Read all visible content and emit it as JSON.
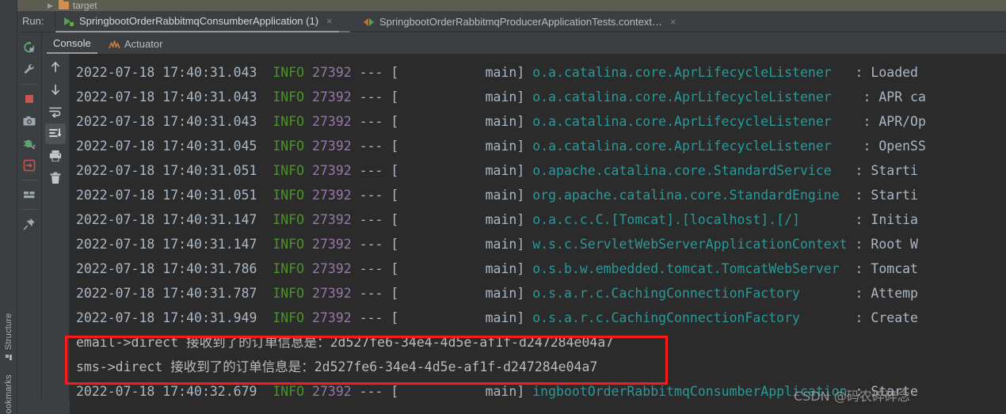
{
  "breadcrumb": {
    "folder_icon": "folder-icon",
    "label": "target"
  },
  "runbar": {
    "run_label": "Run:",
    "tabs": [
      {
        "label": "SpringbootOrderRabbitmqConsumberApplication (1)",
        "icon": "run-green-icon",
        "close": "×",
        "active": true
      },
      {
        "label": "SpringbootOrderRabbitmqProducerApplicationTests.context…",
        "icon": "rerun-arrows-icon",
        "close": "×",
        "active": false
      }
    ]
  },
  "console_tabs": [
    {
      "label": "Console",
      "active": true
    },
    {
      "label": "Actuator",
      "active": false
    }
  ],
  "sidebar_a": [
    {
      "name": "rerun-button",
      "icon": "rerun-icon"
    },
    {
      "name": "settings-button",
      "icon": "wrench-icon"
    },
    {
      "name": "stop-button",
      "icon": "stop-square-icon"
    },
    {
      "name": "screenshot-button",
      "icon": "camera-icon"
    },
    {
      "name": "debug-button",
      "icon": "bug-icon"
    },
    {
      "name": "exit-button",
      "icon": "exit-arrow-icon"
    },
    {
      "name": "layout-button",
      "icon": "layout-icon"
    },
    {
      "name": "pin-button",
      "icon": "pin-icon"
    }
  ],
  "sidebar_b": [
    {
      "name": "scroll-up-button",
      "icon": "arrow-up-icon"
    },
    {
      "name": "scroll-down-button",
      "icon": "arrow-down-icon"
    },
    {
      "name": "soft-wrap-button",
      "icon": "soft-wrap-icon"
    },
    {
      "name": "scroll-to-end-button",
      "icon": "scroll-to-end-icon",
      "selected": true
    },
    {
      "name": "print-button",
      "icon": "printer-icon"
    },
    {
      "name": "clear-all-button",
      "icon": "trash-icon"
    }
  ],
  "rail": {
    "structure": "Structure",
    "bookmarks": "Bookmarks"
  },
  "console": {
    "lines": [
      {
        "type": "log",
        "ts": "2022-07-18 17:40:31.043",
        "level": "INFO",
        "pid": "27392",
        "sep": "--- [",
        "thread": "           main]",
        "logger": "o.a.catalina.core.AprLifecycleListener  ",
        "colon": ":",
        "msg": " Loaded"
      },
      {
        "type": "log",
        "ts": "2022-07-18 17:40:31.043",
        "level": "INFO",
        "pid": "27392",
        "sep": "--- [",
        "thread": "           main]",
        "logger": "o.a.catalina.core.AprLifecycleListener   ",
        "colon": ":",
        "msg": " APR ca"
      },
      {
        "type": "log",
        "ts": "2022-07-18 17:40:31.043",
        "level": "INFO",
        "pid": "27392",
        "sep": "--- [",
        "thread": "           main]",
        "logger": "o.a.catalina.core.AprLifecycleListener   ",
        "colon": ":",
        "msg": " APR/Op"
      },
      {
        "type": "log",
        "ts": "2022-07-18 17:40:31.045",
        "level": "INFO",
        "pid": "27392",
        "sep": "--- [",
        "thread": "           main]",
        "logger": "o.a.catalina.core.AprLifecycleListener   ",
        "colon": ":",
        "msg": " OpenSS"
      },
      {
        "type": "log",
        "ts": "2022-07-18 17:40:31.051",
        "level": "INFO",
        "pid": "27392",
        "sep": "--- [",
        "thread": "           main]",
        "logger": "o.apache.catalina.core.StandardService  ",
        "colon": ":",
        "msg": " Starti"
      },
      {
        "type": "log",
        "ts": "2022-07-18 17:40:31.051",
        "level": "INFO",
        "pid": "27392",
        "sep": "--- [",
        "thread": "           main]",
        "logger": "org.apache.catalina.core.StandardEngine ",
        "colon": ":",
        "msg": " Starti"
      },
      {
        "type": "log",
        "ts": "2022-07-18 17:40:31.147",
        "level": "INFO",
        "pid": "27392",
        "sep": "--- [",
        "thread": "           main]",
        "logger": "o.a.c.c.C.[Tomcat].[localhost].[/]      ",
        "colon": ":",
        "msg": " Initia"
      },
      {
        "type": "log",
        "ts": "2022-07-18 17:40:31.147",
        "level": "INFO",
        "pid": "27392",
        "sep": "--- [",
        "thread": "           main]",
        "logger": "w.s.c.ServletWebServerApplicationContext",
        "colon": ":",
        "msg": " Root W"
      },
      {
        "type": "log",
        "ts": "2022-07-18 17:40:31.786",
        "level": "INFO",
        "pid": "27392",
        "sep": "--- [",
        "thread": "           main]",
        "logger": "o.s.b.w.embedded.tomcat.TomcatWebServer ",
        "colon": ":",
        "msg": " Tomcat"
      },
      {
        "type": "log",
        "ts": "2022-07-18 17:40:31.787",
        "level": "INFO",
        "pid": "27392",
        "sep": "--- [",
        "thread": "           main]",
        "logger": "o.s.a.r.c.CachingConnectionFactory      ",
        "colon": ":",
        "msg": " Attemp"
      },
      {
        "type": "log",
        "ts": "2022-07-18 17:40:31.949",
        "level": "INFO",
        "pid": "27392",
        "sep": "--- [",
        "thread": "           main]",
        "logger": "o.s.a.r.c.CachingConnectionFactory      ",
        "colon": ":",
        "msg": " Create"
      },
      {
        "type": "plain",
        "text": "email->direct 接收到了的订单信息是：2d527fe6-34e4-4d5e-af1f-d247284e04a7"
      },
      {
        "type": "plain",
        "text": "sms->direct 接收到了的订单信息是：2d527fe6-34e4-4d5e-af1f-d247284e04a7"
      },
      {
        "type": "log",
        "ts": "2022-07-18 17:40:32.679",
        "level": "INFO",
        "pid": "27392",
        "sep": "--- [",
        "thread": "           main]",
        "logger": "ingbootOrderRabbitmqConsumberApplication",
        "colon": ":",
        "msg": " Starte"
      }
    ]
  },
  "annotation": {
    "highlight_color": "#ff1a1a",
    "name": "red-highlight-box"
  },
  "watermark": {
    "text": "CSDN @码农碎碎念"
  },
  "colors": {
    "console_bg": "#2b2b2b",
    "ide_bg": "#3c3f41",
    "text": "#a9b7c6",
    "info_green": "#4f8f2f",
    "pid_purple": "#9876aa",
    "logger_teal": "#299999",
    "breadcrumb_bg": "#5c5c50"
  }
}
